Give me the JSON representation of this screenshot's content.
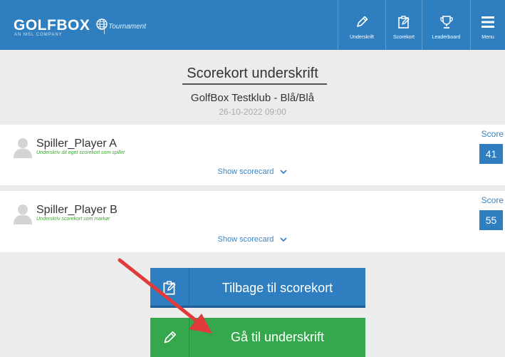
{
  "header": {
    "logo_text": "GOLFBOX",
    "logo_sub": "AN MSL COMPANY",
    "product": "Tournament",
    "nav": [
      {
        "label": "Underskrift",
        "icon": "pen-icon"
      },
      {
        "label": "Scorekort",
        "icon": "scorecard-edit-icon"
      },
      {
        "label": "Leaderboard",
        "icon": "trophy-icon"
      },
      {
        "label": "Menu",
        "icon": "hamburger-menu-icon"
      }
    ]
  },
  "page": {
    "title": "Scorekort underskrift",
    "club": "GolfBox Testklub - Blå/Blå",
    "datetime": "26-10-2022 09:00"
  },
  "players": [
    {
      "name": "Spiller_Player A",
      "note": "Underskriv dit eget scorekort som spiller",
      "score_label": "Score",
      "score": "41",
      "show_link": "Show scorecard"
    },
    {
      "name": "Spiller_Player B",
      "note": "Underskriv scorekort som markør",
      "score_label": "Score",
      "score": "55",
      "show_link": "Show scorecard"
    }
  ],
  "buttons": {
    "back": "Tilbage til scorekort",
    "sign": "Gå til underskrift"
  },
  "colors": {
    "header": "#2f7fc0",
    "primary": "#2f7fc0",
    "success": "#35a84d",
    "annotation_arrow": "#e03a3a"
  }
}
